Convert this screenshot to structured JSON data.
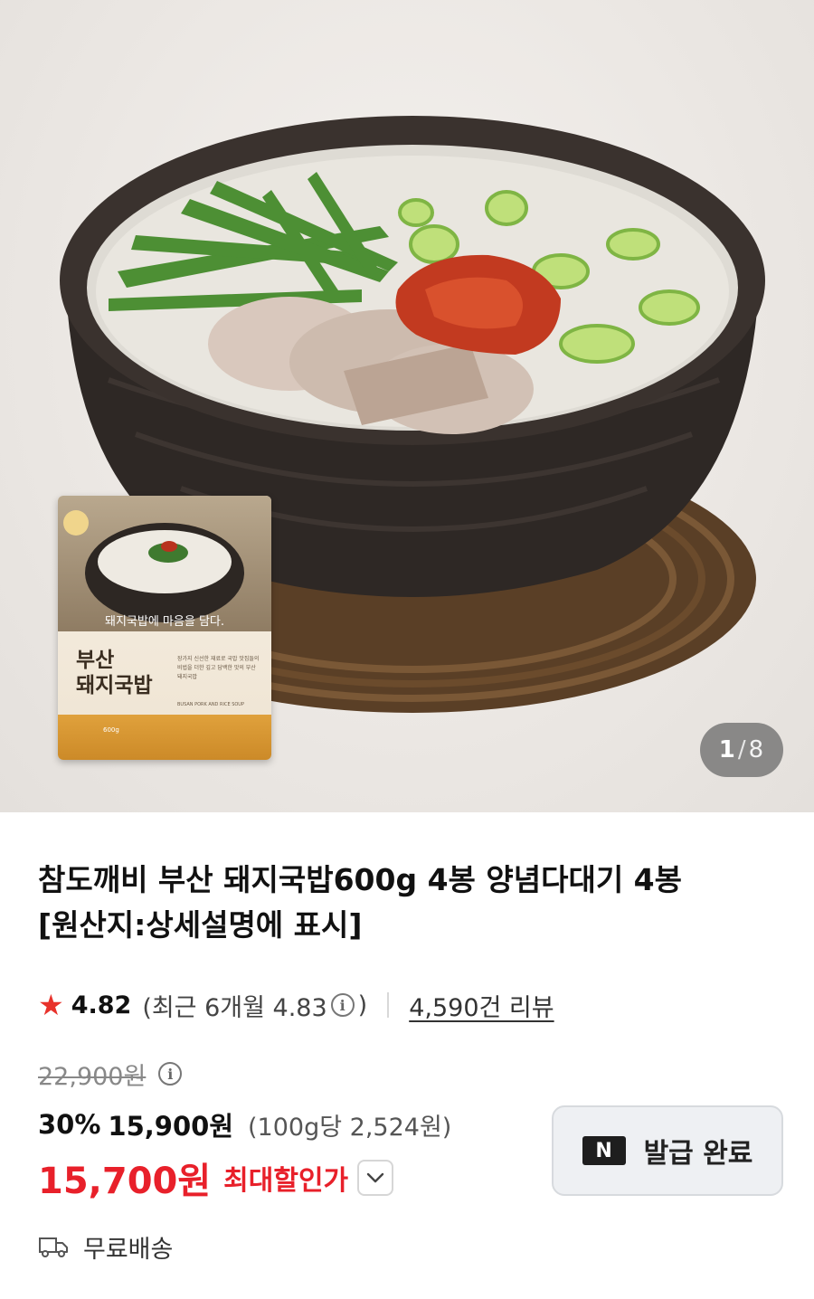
{
  "gallery": {
    "current": "1",
    "separator": "/",
    "total": "8",
    "package": {
      "tagline": "돼지국밥에 마음을 담다.",
      "name_line1": "부산",
      "name_line2": "돼지국밥",
      "description": "장가지 신선한 재료로 국밥 맛집들의 비법을 더한 깊고 담백한 맛의 부산 돼지국밥",
      "subtitle": "BUSAN PORK AND RICE SOUP",
      "weight": "600g"
    }
  },
  "product": {
    "title_line1": "참도깨비 부산 돼지국밥600g 4봉 양념다대기 4봉",
    "title_line2": "[원산지:상세설명에 표시]"
  },
  "rating": {
    "score": "4.82",
    "recent_prefix": "(최근 6개월 4.83",
    "recent_suffix": ")",
    "info_glyph": "i",
    "review_link": "4,590건 리뷰"
  },
  "price": {
    "original": "22,900원",
    "info_glyph": "i",
    "discount_pct": "30%",
    "sale": "15,900원",
    "unit_price": "(100g당 2,524원)",
    "best": "15,700원",
    "best_label": "최대할인가"
  },
  "coupon": {
    "badge": "N",
    "label": "발급 완료"
  },
  "shipping": {
    "label": "무료배송"
  },
  "colors": {
    "accent_red": "#e8202a",
    "star": "#e8322b",
    "counter_bg": "#6e6e6e"
  }
}
